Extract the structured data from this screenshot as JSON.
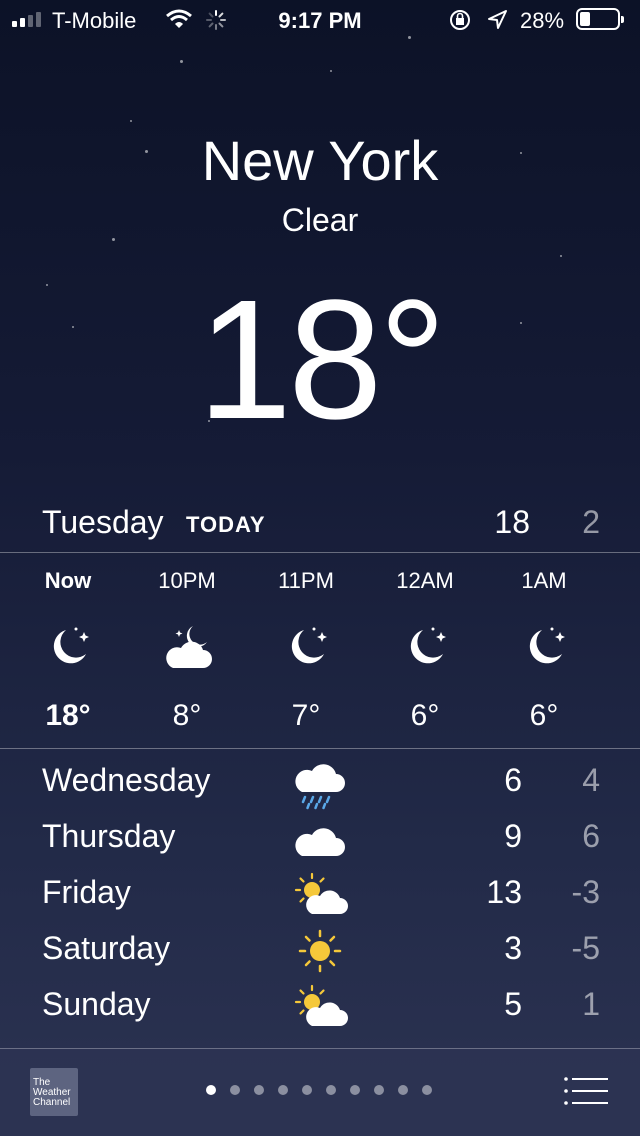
{
  "status_bar": {
    "carrier": "T-Mobile",
    "time": "9:17 PM",
    "battery_percent": "28%",
    "battery_level": 0.28,
    "signal_bars": 2,
    "signal_total": 4
  },
  "location": {
    "city": "New York",
    "condition": "Clear",
    "temperature": "18°"
  },
  "today": {
    "day": "Tuesday",
    "label": "TODAY",
    "high": "18",
    "low": "2"
  },
  "hourly": [
    {
      "time": "Now",
      "icon": "moon-stars-icon",
      "temp": "18°"
    },
    {
      "time": "10PM",
      "icon": "cloud-moon-icon",
      "temp": "8°"
    },
    {
      "time": "11PM",
      "icon": "moon-stars-icon",
      "temp": "7°"
    },
    {
      "time": "12AM",
      "icon": "moon-stars-icon",
      "temp": "6°"
    },
    {
      "time": "1AM",
      "icon": "moon-stars-icon",
      "temp": "6°"
    }
  ],
  "daily": [
    {
      "day": "Wednesday",
      "icon": "rain-cloud-icon",
      "high": "6",
      "low": "4"
    },
    {
      "day": "Thursday",
      "icon": "cloud-icon",
      "high": "9",
      "low": "6"
    },
    {
      "day": "Friday",
      "icon": "partly-sunny-icon",
      "high": "13",
      "low": "-3"
    },
    {
      "day": "Saturday",
      "icon": "sun-icon",
      "high": "3",
      "low": "-5"
    },
    {
      "day": "Sunday",
      "icon": "partly-sunny-icon",
      "high": "5",
      "low": "1"
    }
  ],
  "footer": {
    "weather_channel_logo": "The Weather Channel",
    "page_count": 10,
    "active_page": 0
  },
  "colors": {
    "sun": "#f5c83a",
    "rain": "#5aa8e8"
  }
}
